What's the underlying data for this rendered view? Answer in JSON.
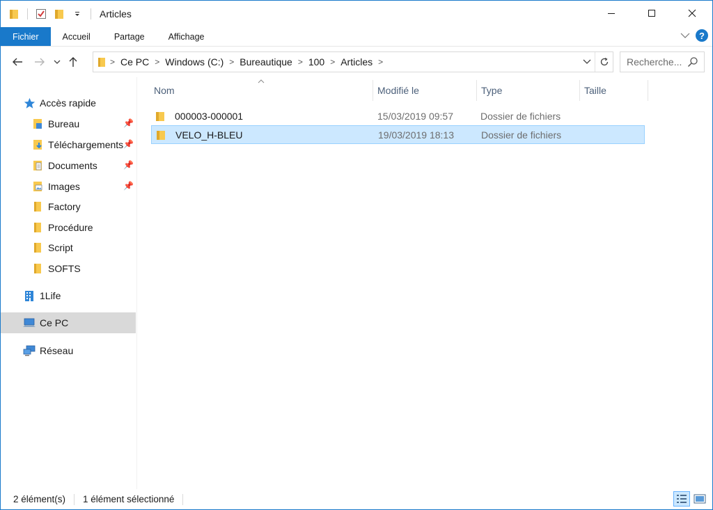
{
  "window": {
    "title": "Articles",
    "controls": {
      "minimize_icon": "minimize-icon",
      "maximize_icon": "maximize-icon",
      "close_icon": "close-icon"
    }
  },
  "ribbon": {
    "tabs": [
      {
        "label": "Fichier",
        "active": true
      },
      {
        "label": "Accueil"
      },
      {
        "label": "Partage"
      },
      {
        "label": "Affichage"
      }
    ],
    "accent": "#1979ca"
  },
  "address": {
    "path": [
      "Ce PC",
      "Windows (C:)",
      "Bureautique",
      "100",
      "Articles"
    ]
  },
  "search": {
    "placeholder": "Recherche..."
  },
  "sidebar": {
    "quick_access": {
      "label": "Accès rapide",
      "items": [
        {
          "label": "Bureau",
          "pinned": true
        },
        {
          "label": "Téléchargements",
          "pinned": true
        },
        {
          "label": "Documents",
          "pinned": true
        },
        {
          "label": "Images",
          "pinned": true
        },
        {
          "label": "Factory"
        },
        {
          "label": "Procédure"
        },
        {
          "label": "Script"
        },
        {
          "label": "SOFTS"
        }
      ]
    },
    "onedrive": {
      "label": "1Life"
    },
    "this_pc": {
      "label": "Ce PC",
      "selected": true
    },
    "network": {
      "label": "Réseau"
    }
  },
  "columns": {
    "name": "Nom",
    "modified": "Modifié le",
    "type": "Type",
    "size": "Taille"
  },
  "files": [
    {
      "name": "000003-000001",
      "modified": "15/03/2019 09:57",
      "type": "Dossier de fichiers",
      "selected": false
    },
    {
      "name": "VELO_H-BLEU",
      "modified": "19/03/2019 18:13",
      "type": "Dossier de fichiers",
      "selected": true
    }
  ],
  "status": {
    "count": "2 élément(s)",
    "selection": "1 élément sélectionné"
  },
  "colors": {
    "selection_bg": "#cce8ff",
    "selection_border": "#99d1ff",
    "folder_yellow": "#f8c94e",
    "nav_selected": "#d9d9d9"
  }
}
